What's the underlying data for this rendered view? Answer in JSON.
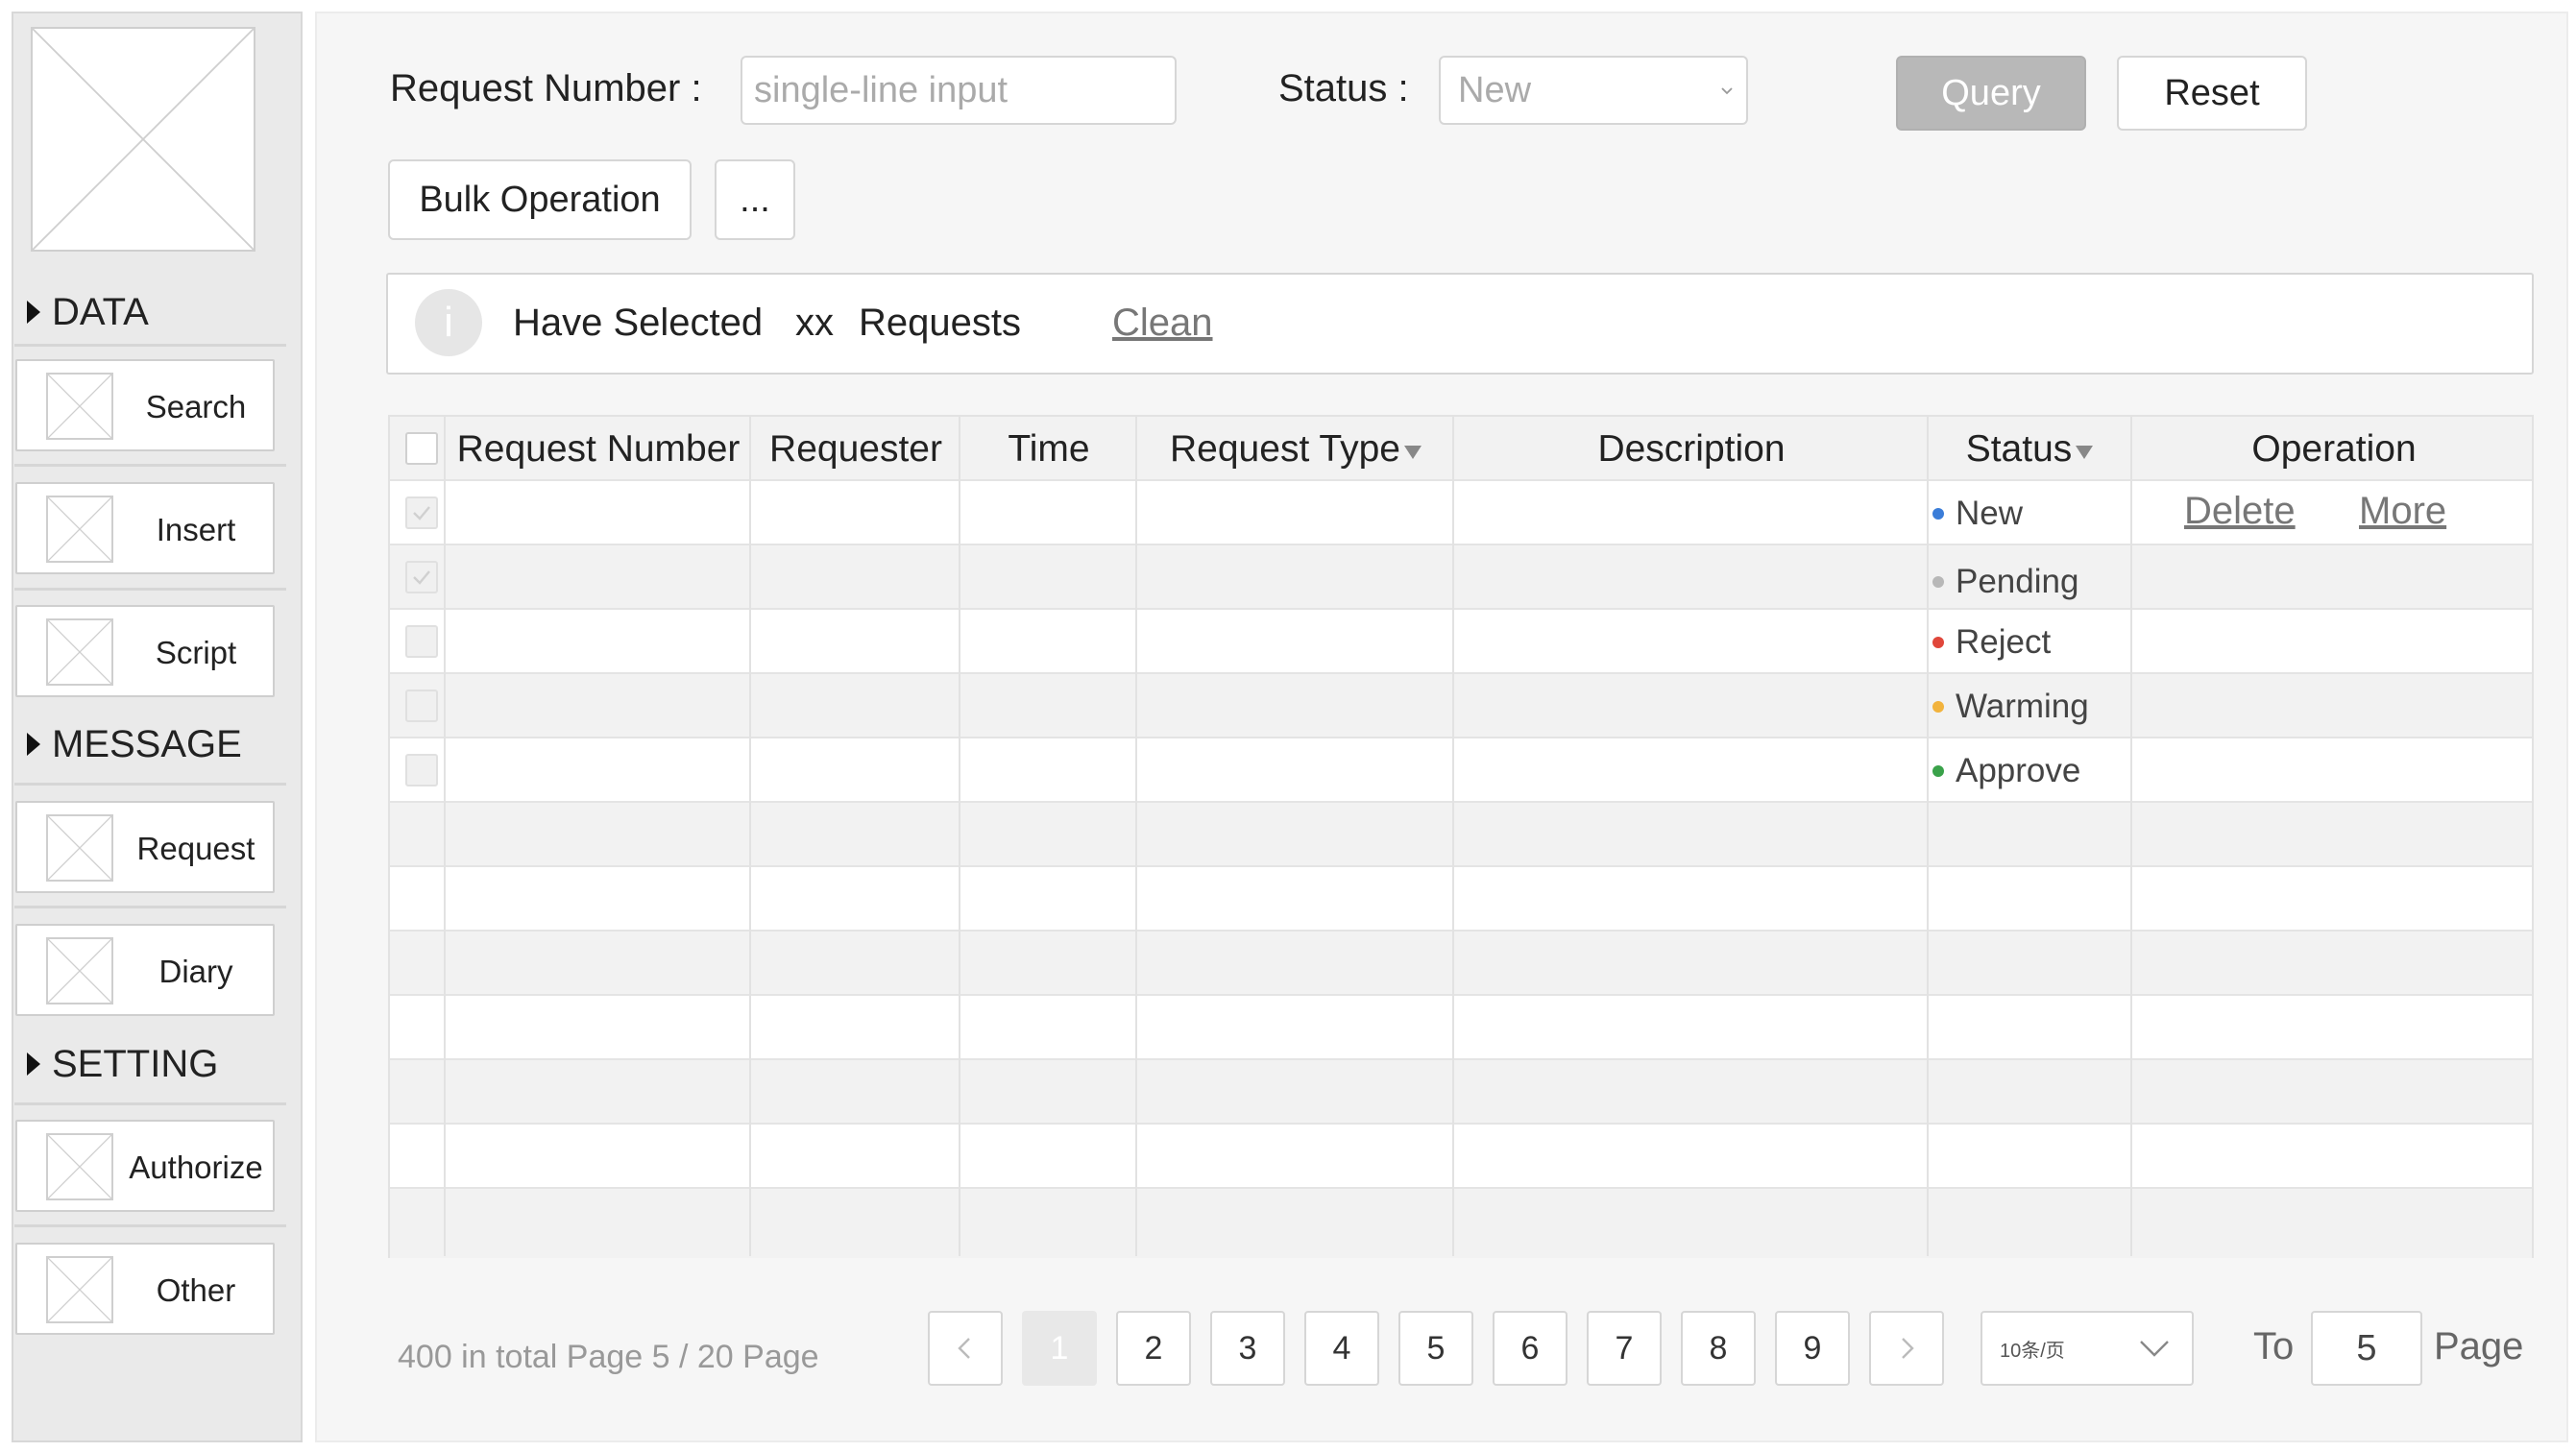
{
  "sidebar": {
    "sections": [
      {
        "title": "DATA",
        "items": [
          {
            "label": "Search"
          },
          {
            "label": "Insert"
          },
          {
            "label": "Script"
          }
        ]
      },
      {
        "title": "MESSAGE",
        "items": [
          {
            "label": "Request"
          },
          {
            "label": "Diary"
          }
        ]
      },
      {
        "title": "SETTING",
        "items": [
          {
            "label": "Authorize"
          },
          {
            "label": "Other"
          }
        ]
      }
    ]
  },
  "filters": {
    "request_number_label": "Request Number :",
    "request_number_placeholder": "single-line input",
    "status_label": "Status :",
    "status_value": "New",
    "query_label": "Query",
    "reset_label": "Reset"
  },
  "actions": {
    "bulk_label": "Bulk Operation",
    "more_label": "..."
  },
  "selection": {
    "prefix": "Have Selected",
    "count": "xx",
    "suffix": "Requests",
    "clean_label": "Clean",
    "info_glyph": "i"
  },
  "table": {
    "columns": [
      "Request Number",
      "Requester",
      "Time",
      "Request Type",
      "Description",
      "Status",
      "Operation"
    ],
    "rows": [
      {
        "checked": true,
        "status": "New",
        "status_color": "#3b7dd8",
        "ops": [
          "Delete",
          "More"
        ]
      },
      {
        "checked": true,
        "status": "Pending",
        "status_color": "#b8b8b8"
      },
      {
        "checked": false,
        "status": "Reject",
        "status_color": "#e0473b"
      },
      {
        "checked": false,
        "status": "Warming",
        "status_color": "#f2b33d"
      },
      {
        "checked": false,
        "status": "Approve",
        "status_color": "#3aa24a"
      },
      {},
      {},
      {},
      {},
      {},
      {},
      {}
    ]
  },
  "pagination": {
    "summary": "400 in total Page 5 / 20 Page",
    "pages": [
      "1",
      "2",
      "3",
      "4",
      "5",
      "6",
      "7",
      "8",
      "9"
    ],
    "active_page": "1",
    "page_size": "10条/页",
    "goto_prefix": "To",
    "goto_value": "5",
    "goto_suffix": "Page"
  }
}
